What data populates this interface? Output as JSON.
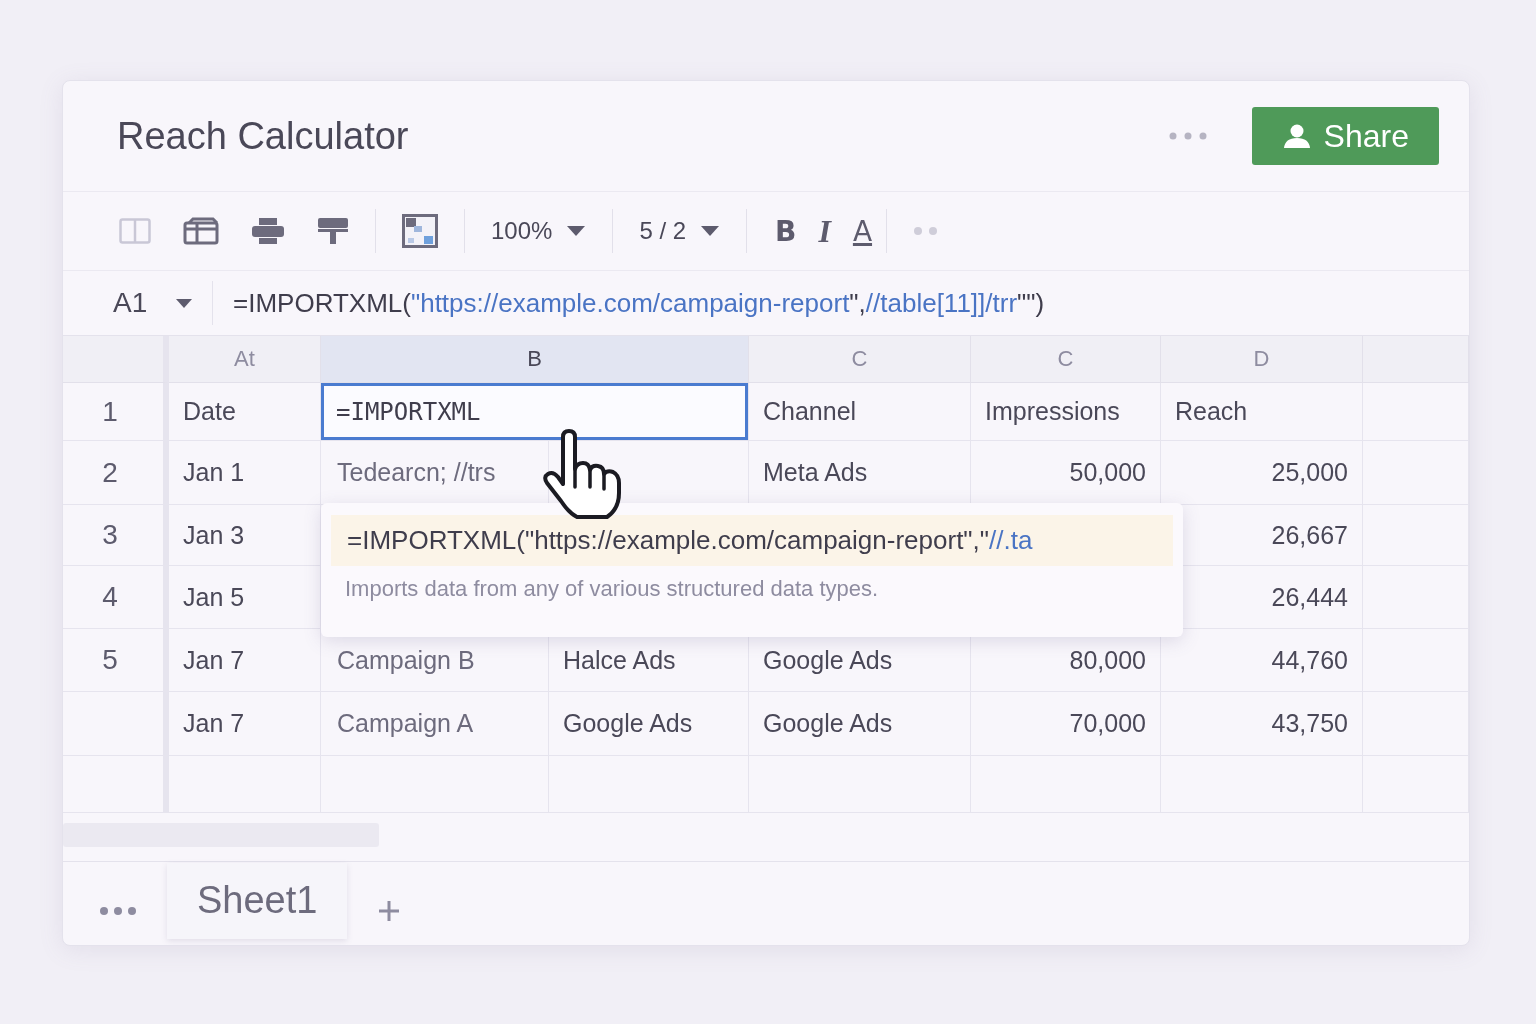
{
  "window": {
    "title": "Reach Calculator"
  },
  "share_button": {
    "label": "Share"
  },
  "toolbar": {
    "zoom": "100%",
    "font_size": "5 / 2",
    "bold": "B",
    "italic": "I",
    "text_color": "A"
  },
  "formula_bar": {
    "cell_ref": "A1",
    "formula": [
      {
        "kind": "plain",
        "text": "=IMPORTXML("
      },
      {
        "kind": "string",
        "text": "\"https://example.com/campaign-report"
      },
      {
        "kind": "plain",
        "text": "\","
      },
      {
        "kind": "string",
        "text": "//table[11]]/trr"
      },
      {
        "kind": "plain",
        "text": "\"\")"
      }
    ]
  },
  "column_headers": [
    {
      "label": "At",
      "selected": false
    },
    {
      "label": "B",
      "selected": true
    },
    {
      "label": "C",
      "selected": false
    },
    {
      "label": "C",
      "selected": false
    },
    {
      "label": "D",
      "selected": false
    }
  ],
  "rows": [
    {
      "number": "1",
      "kind": "header",
      "cells": [
        "Date",
        "=IMPORTXML",
        null,
        "Channel",
        "Impressions",
        "Reach"
      ]
    },
    {
      "number": "2",
      "kind": "data",
      "cells": [
        "Jan 1",
        "Tedearcn; //trs",
        null,
        "Meta Ads",
        "50,000",
        "25,000"
      ]
    },
    {
      "number": "3",
      "kind": "data",
      "cells": [
        "Jan 3",
        null,
        null,
        null,
        null,
        "26,667"
      ]
    },
    {
      "number": "4",
      "kind": "data",
      "cells": [
        "Jan 5",
        null,
        null,
        null,
        null,
        "26,444"
      ]
    },
    {
      "number": "5",
      "kind": "data",
      "cells": [
        "Jan 7",
        "Campaign B",
        "Halce Ads",
        "Google Ads",
        "80,000",
        "44,760"
      ]
    },
    {
      "kind": "data",
      "cells": [
        "Jan 7",
        "Campaign A",
        "Google Ads",
        "Google Ads",
        "70,000",
        "43,750"
      ]
    },
    {
      "kind": "empty",
      "cells": []
    }
  ],
  "autocomplete": {
    "formula": [
      {
        "kind": "plain",
        "text": "=IMPORTXML(\"https://example.com/campaign-report\",\""
      },
      {
        "kind": "string",
        "text": "//.ta"
      }
    ],
    "description": "Imports data from any of various structured data types."
  },
  "sheet_tabs": [
    {
      "label": "Sheet1",
      "selected": true
    }
  ]
}
